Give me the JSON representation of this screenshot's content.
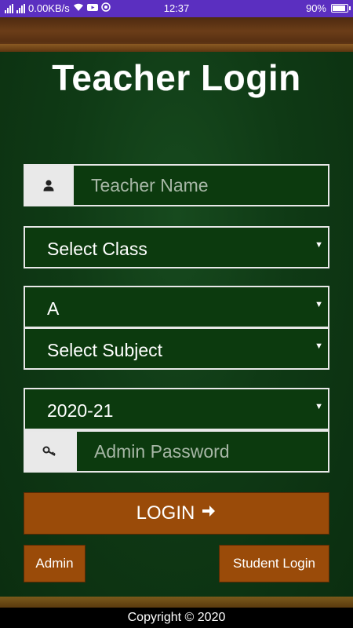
{
  "status_bar": {
    "speed": "0.00KB/s",
    "time": "12:37",
    "battery": "90%"
  },
  "page": {
    "title": "Teacher Login"
  },
  "form": {
    "teacher_name_placeholder": "Teacher Name",
    "class_select": "Select Class",
    "section_select": "A",
    "subject_select": "Select Subject",
    "year_select": "2020-21",
    "password_placeholder": "Admin Password"
  },
  "buttons": {
    "login": "LOGIN",
    "admin": "Admin",
    "student_login": "Student Login"
  },
  "footer": {
    "copyright": "Copyright © 2020"
  },
  "colors": {
    "board": "#0f3a15",
    "button": "#9a4b09",
    "status_bar": "#5b2fc0"
  }
}
